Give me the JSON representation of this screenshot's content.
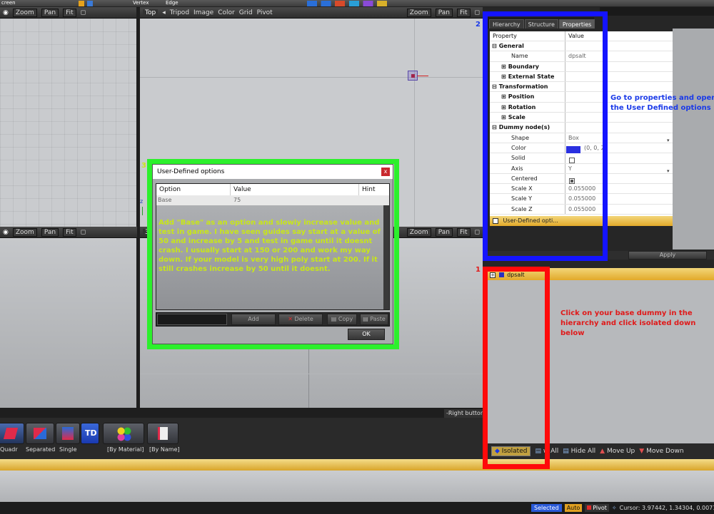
{
  "top_toolbar": {
    "file_label": "creen",
    "zoom": "Zoom",
    "pan": "Pan",
    "fit": "Fit",
    "vertex": "Vertex",
    "edge": "Edge"
  },
  "viewport_top": {
    "view": "Top",
    "menu": [
      "Tripod",
      "Image",
      "Color",
      "Grid",
      "Pivot"
    ],
    "zoom": "Zoom",
    "pan": "Pan",
    "fit": "Fit"
  },
  "viewport_left": {
    "zoom": "Zoom",
    "pan": "Pan",
    "fit": "Fit"
  },
  "viewport_bottom_left": {
    "zoom": "Zoom",
    "pan": "Pan",
    "fit": "Fit"
  },
  "viewport_bottom_right": {
    "label": "3D",
    "zoom": "Zoom",
    "pan": "Pan",
    "fit": "Fit"
  },
  "axis_marker": "z",
  "panel": {
    "tabs": [
      "Hierarchy",
      "Structure",
      "Properties"
    ],
    "header": {
      "property": "Property",
      "value": "Value"
    },
    "rows": [
      {
        "sign": "⊟",
        "label": "General",
        "value": "",
        "group": true
      },
      {
        "sign": "",
        "label": "Name",
        "value": "dpsalt",
        "group": false
      },
      {
        "sign": "⊞",
        "label": "Boundary",
        "value": "",
        "group": true
      },
      {
        "sign": "⊞",
        "label": "External State",
        "value": "",
        "group": true
      },
      {
        "sign": "⊟",
        "label": "Transformation",
        "value": "",
        "group": true
      },
      {
        "sign": "⊞",
        "label": "Position",
        "value": "",
        "group": true
      },
      {
        "sign": "⊞",
        "label": "Rotation",
        "value": "",
        "group": true
      },
      {
        "sign": "⊞",
        "label": "Scale",
        "value": "",
        "group": true
      },
      {
        "sign": "⊟",
        "label": "Dummy node(s)",
        "value": "",
        "group": true
      },
      {
        "sign": "",
        "label": "Shape",
        "value": "Box",
        "group": false
      },
      {
        "sign": "",
        "label": "Color",
        "value": "(0, 0, 2",
        "group": false
      },
      {
        "sign": "",
        "label": "Solid",
        "value": "",
        "group": false
      },
      {
        "sign": "",
        "label": "Axis",
        "value": "Y",
        "group": false
      },
      {
        "sign": "",
        "label": "Centered",
        "value": "",
        "group": false
      },
      {
        "sign": "",
        "label": "Scale X",
        "value": "0.055000",
        "group": false
      },
      {
        "sign": "",
        "label": "Scale Y",
        "value": "0.055000",
        "group": false
      },
      {
        "sign": "",
        "label": "Scale Z",
        "value": "0.055000",
        "group": false
      }
    ],
    "user_defined": "User-Defined opti...",
    "apply": "Apply"
  },
  "hierarchy_tree": {
    "item": "dpsalt"
  },
  "hierarchy_toolbar": {
    "isolated": "Isolated",
    "show_all": "w All",
    "hide_all": "Hide All",
    "move_up": "Move Up",
    "move_down": "Move Down"
  },
  "dialog": {
    "title": "User-Defined options",
    "close": "x",
    "columns": {
      "option": "Option",
      "value": "Value",
      "hint": "Hint"
    },
    "row": {
      "option": "Base",
      "value": "75"
    },
    "buttons": {
      "add": "Add",
      "delete": "Delete",
      "copy": "Copy",
      "paste": "Paste",
      "ok": "OK"
    }
  },
  "annotations": {
    "num1": "1",
    "num2": "2",
    "num3": "3",
    "blue_text": "Go to properties and open the User Defined options",
    "red_text": "Click on your base dummy in the hierarchy and click isolated down below",
    "green_text": "Add \"Base\" as an option and slowly increase value and test in game. I have seen guides say start at a value of 50 and increase by 5 and test in game until it doesnt crash. I usually start at 150 or 200 and work my way down. If your model is very high poly start at 200. If it still crashes increase by 50 until it doesnt."
  },
  "right_button_label": "-Right button",
  "bottom_toolbar": {
    "labels": [
      "Quadr",
      "Separated",
      "Single",
      "[By Material]",
      "[By Name]"
    ],
    "td_label": "TD"
  },
  "status": {
    "selected": "Selected",
    "auto": "Auto",
    "pivot": "Pivot",
    "cursor": "Cursor: 3.97442, 1.34304, 0.00714"
  },
  "colors": {
    "blue": "#1414ff",
    "red": "#ff0a0a",
    "green": "#2cf02c",
    "annot_yellow": "#c8e619",
    "annot_red": "#e01919",
    "annot_blue": "#1a3ae8"
  }
}
